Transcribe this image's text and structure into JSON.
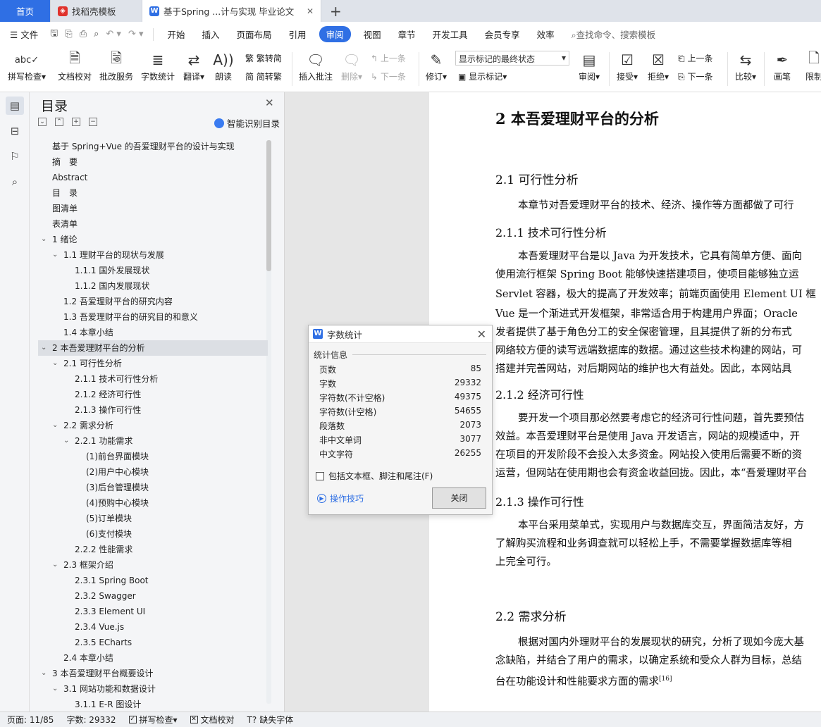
{
  "tabs": {
    "home": "首页",
    "template": "找稻壳模板",
    "doc": "基于Spring ...计与实现 毕业论文"
  },
  "menu": {
    "file": "文件",
    "items": [
      "开始",
      "插入",
      "页面布局",
      "引用",
      "审阅",
      "视图",
      "章节",
      "开发工具",
      "会员专享",
      "效率"
    ],
    "active": "审阅",
    "search": "查找命令、搜索模板"
  },
  "ribbon": {
    "spellcheck": "拼写检查",
    "doc_proof": "文档校对",
    "review_service": "批改服务",
    "word_count": "字数统计",
    "translate": "翻译",
    "read_aloud": "朗读",
    "trad_to_simp": "繁转简",
    "simp_to_trad": "简转繁",
    "insert_comment": "插入批注",
    "delete": "删除",
    "prev_comment": "上一条",
    "next_comment": "下一条",
    "track": "修订",
    "markup_mode": "显示标记的最终状态",
    "show_markup": "显示标记",
    "review_pane": "审阅",
    "accept": "接受",
    "reject": "拒绝",
    "prev_change": "上一条",
    "next_change": "下一条",
    "compare": "比较",
    "pen": "画笔",
    "restrict": "限制"
  },
  "toc": {
    "title": "目录",
    "smart_toc": "智能识别目录",
    "items": [
      {
        "label": "基于 Spring+Vue 的吾爱理财平台的设计与实现",
        "level": 0,
        "chev": ""
      },
      {
        "label": "摘　要",
        "level": 0,
        "chev": ""
      },
      {
        "label": "Abstract",
        "level": 0,
        "chev": ""
      },
      {
        "label": "目　录",
        "level": 0,
        "chev": ""
      },
      {
        "label": "图清单",
        "level": 0,
        "chev": ""
      },
      {
        "label": "表清单",
        "level": 0,
        "chev": ""
      },
      {
        "label": "1  绪论",
        "level": 0,
        "chev": "v"
      },
      {
        "label": "1.1  理财平台的现状与发展",
        "level": 1,
        "chev": "v"
      },
      {
        "label": "1.1.1  国外发展现状",
        "level": 2,
        "chev": ""
      },
      {
        "label": "1.1.2  国内发展现状",
        "level": 2,
        "chev": ""
      },
      {
        "label": "1.2 吾爱理财平台的研究内容",
        "level": 1,
        "chev": ""
      },
      {
        "label": "1.3  吾爱理财平台的研究目的和意义",
        "level": 1,
        "chev": ""
      },
      {
        "label": "1.4  本章小结",
        "level": 1,
        "chev": ""
      },
      {
        "label": "2  本吾爱理财平台的分析",
        "level": 0,
        "chev": "v",
        "sel": true
      },
      {
        "label": "2.1  可行性分析",
        "level": 1,
        "chev": "v"
      },
      {
        "label": "2.1.1  技术可行性分析",
        "level": 2,
        "chev": ""
      },
      {
        "label": "2.1.2  经济可行性",
        "level": 2,
        "chev": ""
      },
      {
        "label": "2.1.3  操作可行性",
        "level": 2,
        "chev": ""
      },
      {
        "label": "2.2  需求分析",
        "level": 1,
        "chev": "v"
      },
      {
        "label": "2.2.1  功能需求",
        "level": 2,
        "chev": "v"
      },
      {
        "label": "(1)前台界面模块",
        "level": 3,
        "chev": ""
      },
      {
        "label": "(2)用户中心模块",
        "level": 3,
        "chev": ""
      },
      {
        "label": "(3)后台管理模块",
        "level": 3,
        "chev": ""
      },
      {
        "label": "(4)预购中心模块",
        "level": 3,
        "chev": ""
      },
      {
        "label": "(5)订单模块",
        "level": 3,
        "chev": ""
      },
      {
        "label": "(6)支付模块",
        "level": 3,
        "chev": ""
      },
      {
        "label": "2.2.2  性能需求",
        "level": 2,
        "chev": ""
      },
      {
        "label": "2.3  框架介绍",
        "level": 1,
        "chev": "v"
      },
      {
        "label": "2.3.1 Spring Boot",
        "level": 2,
        "chev": ""
      },
      {
        "label": "2.3.2 Swagger",
        "level": 2,
        "chev": ""
      },
      {
        "label": "2.3.3 Element UI",
        "level": 2,
        "chev": ""
      },
      {
        "label": "2.3.4 Vue.js",
        "level": 2,
        "chev": ""
      },
      {
        "label": "2.3.5 ECharts",
        "level": 2,
        "chev": ""
      },
      {
        "label": "2.4  本章小结",
        "level": 1,
        "chev": ""
      },
      {
        "label": "3  本吾爱理财平台概要设计",
        "level": 0,
        "chev": "v"
      },
      {
        "label": "3.1  网站功能和数据设计",
        "level": 1,
        "chev": "v"
      },
      {
        "label": "3.1.1 E-R 图设计",
        "level": 2,
        "chev": ""
      }
    ]
  },
  "doc": {
    "h1": "2  本吾爱理财平台的分析",
    "h2_1": "2.1  可行性分析",
    "p_1": "本章节对吾爱理财平台的技术、经济、操作等方面都做了可行",
    "h3_1": "2.1.1  技术可行性分析",
    "p_2a": "本吾爱理财平台是以 Java 为开发技术，它具有简单方便、面向",
    "p_2b": "使用流行框架 Spring Boot 能够快速搭建项目，使项目能够独立运",
    "p_2c": "Servlet 容器，极大的提高了开发效率；前端页面使用 Element UI 框",
    "p_2d": "Vue 是一个渐进式开发框架，非常适合用于构建用户界面；Oracle",
    "p_2e": "发者提供了基于角色分工的安全保密管理，且其提供了新的分布式",
    "p_2f": "网络较方便的读写远端数据库的数据。通过这些技术构建的网站，可",
    "p_2g": "搭建并完善网站，对后期网站的维护也大有益处。因此，本网站具",
    "h3_2": "2.1.2  经济可行性",
    "p_3a": "要开发一个项目那必然要考虑它的经济可行性问题，首先要预估",
    "p_3b": "效益。本吾爱理财平台是使用 Java 开发语言，网站的规模适中，开",
    "p_3c": "在项目的开发阶段不会投入太多资金。网站投入使用后需要不断的资",
    "p_3d": "运营，但网站在使用期也会有资金收益回拢。因此，本“吾爱理财平台",
    "h3_3": "2.1.3  操作可行性",
    "p_4a": "本平台采用菜单式，实现用户与数据库交互，界面简洁友好，方",
    "p_4b": "了解购买流程和业务调查就可以轻松上手，不需要掌握数据库等相",
    "p_4c": "上完全可行。",
    "h2_2": "2.2  需求分析",
    "p_5a": "根据对国内外理财平台的发展现状的研究，分析了现如今庞大基",
    "p_5b": "念缺陷，并结合了用户的需求，以确定系统和受众人群为目标，总结",
    "p_5c": "台在功能设计和性能要求方面的需求",
    "ref_16": "[16]"
  },
  "dialog": {
    "title": "字数统计",
    "section": "统计信息",
    "rows": [
      {
        "label": "页数",
        "value": "85"
      },
      {
        "label": "字数",
        "value": "29332"
      },
      {
        "label": "字符数(不计空格)",
        "value": "49375"
      },
      {
        "label": "字符数(计空格)",
        "value": "54655"
      },
      {
        "label": "段落数",
        "value": "2073"
      },
      {
        "label": "非中文单词",
        "value": "3077"
      },
      {
        "label": "中文字符",
        "value": "26255"
      }
    ],
    "include": "包括文本框、脚注和尾注(F)",
    "tips": "操作技巧",
    "close": "关闭"
  },
  "status": {
    "page": "页面: 11/85",
    "words": "字数: 29332",
    "spell": "拼写检查",
    "proof": "文档校对",
    "missing_font": "缺失字体"
  }
}
